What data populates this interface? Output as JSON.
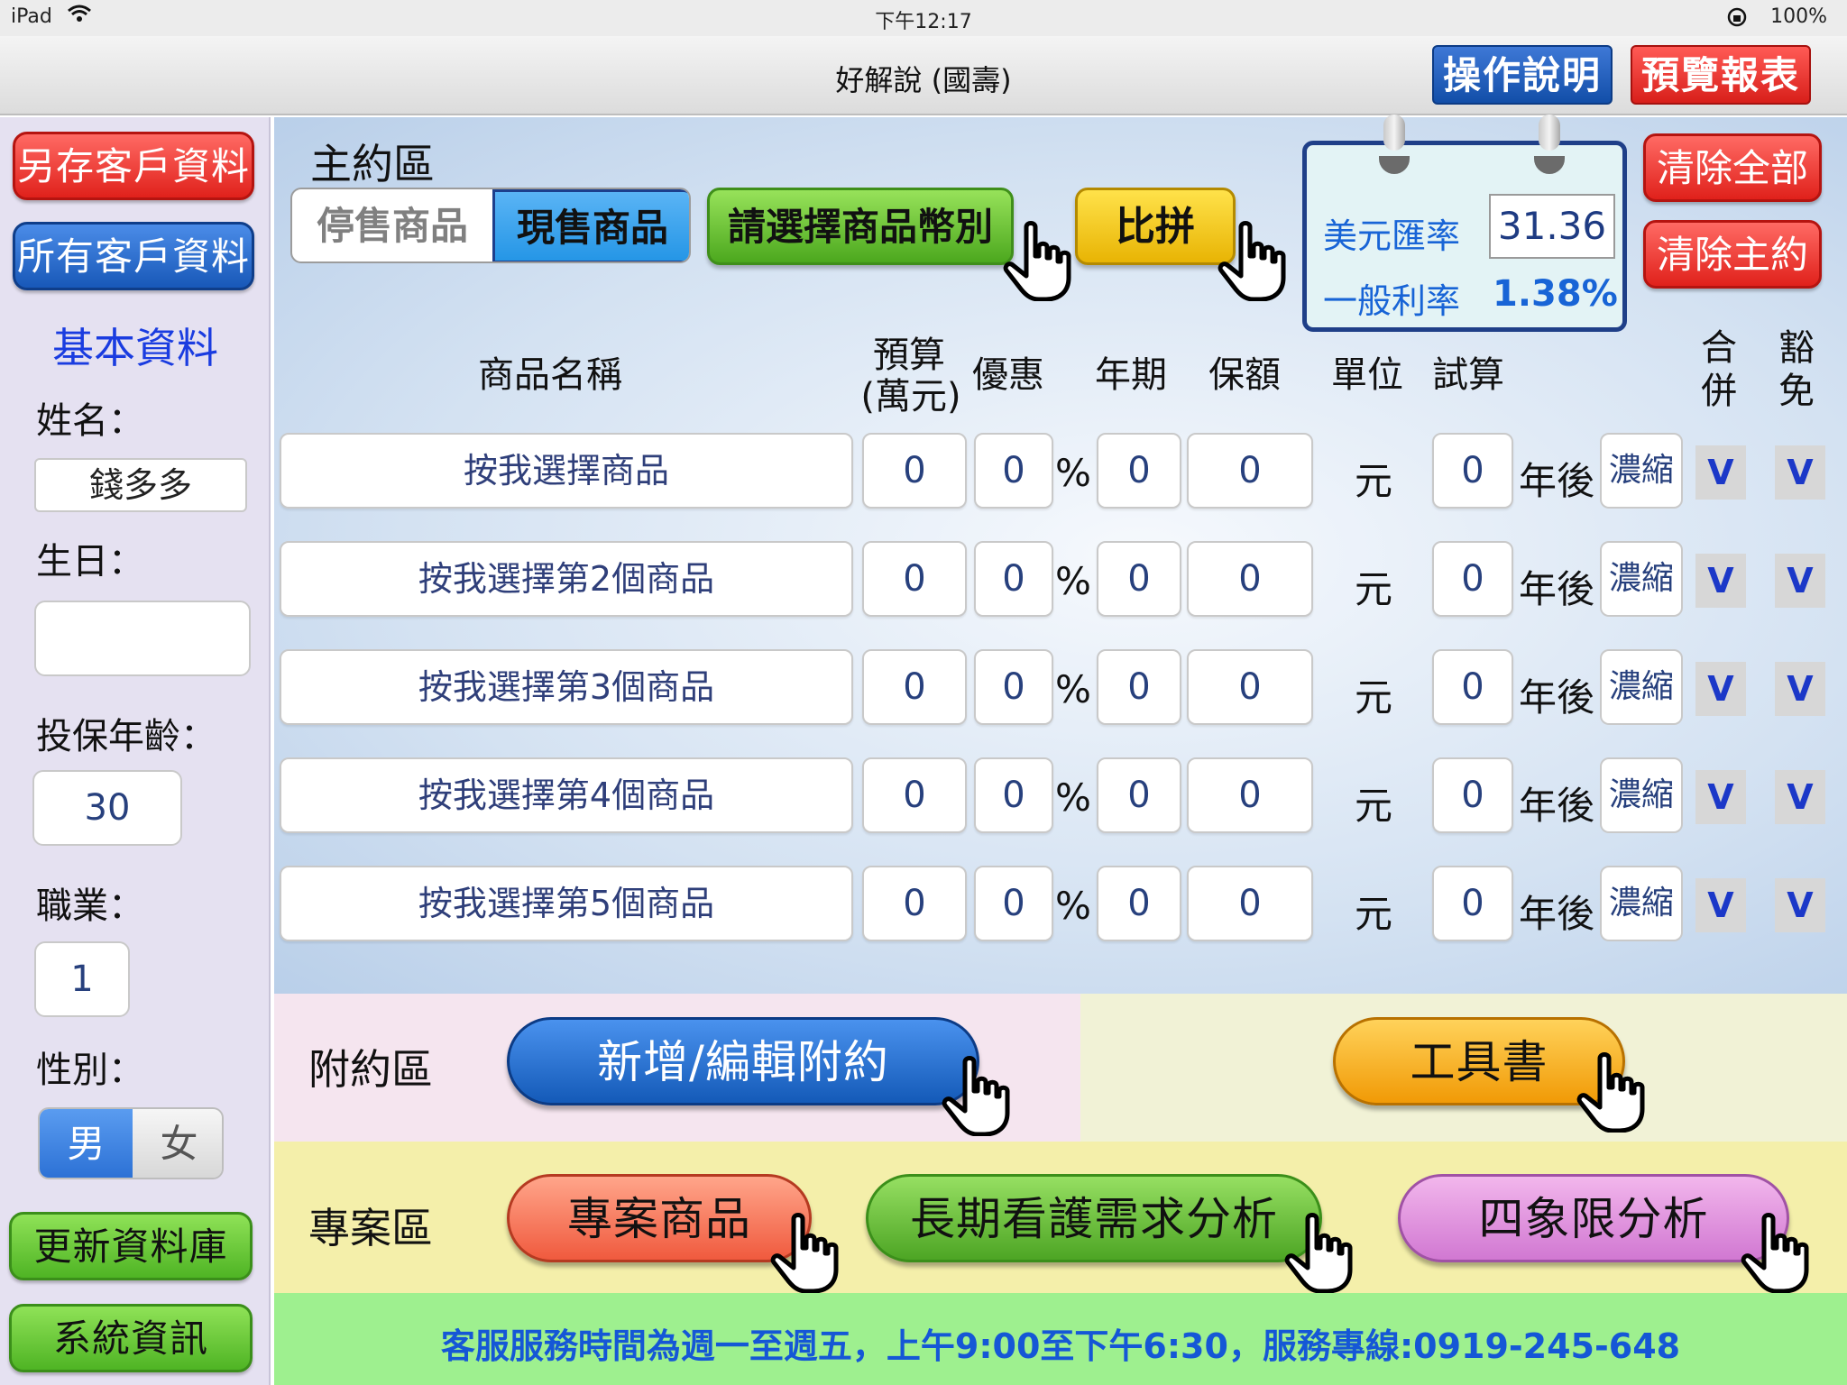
{
  "status_bar": {
    "device": "iPad",
    "time": "下午12:17",
    "battery": "100%"
  },
  "nav": {
    "title": "好解說 (國壽)",
    "help_label": "操作說明",
    "preview_label": "預覽報表"
  },
  "sidebar": {
    "save_client_label": "另存客戶資料",
    "all_clients_label": "所有客戶資料",
    "section_title": "基本資料",
    "name_label": "姓名：",
    "name_value": "錢多多",
    "birthday_label": "生日：",
    "birthday_value": "",
    "age_label": "投保年齡：",
    "age_value": "30",
    "job_label": "職業：",
    "job_value": "1",
    "gender_label": "性別：",
    "gender_options": [
      "男",
      "女"
    ],
    "gender_selected": "男",
    "update_db_label": "更新資料庫",
    "system_info_label": "系統資訊"
  },
  "main": {
    "title": "主約區",
    "tabs": [
      "停售商品",
      "現售商品"
    ],
    "active_tab": "現售商品",
    "currency_button": "請選擇商品幣別",
    "compare_button": "比拼",
    "rates": {
      "usd_label": "美元匯率",
      "usd_value": "31.36",
      "general_label": "一般利率",
      "general_value": "1.38%"
    },
    "clear_all": "清除全部",
    "clear_main": "清除主約",
    "headers": {
      "product": "商品名稱",
      "budget_1": "預算",
      "budget_2": "(萬元)",
      "discount": "優惠",
      "term": "年期",
      "coverage": "保額",
      "unit": "單位",
      "trial": "試算",
      "merge_1": "合",
      "merge_2": "併",
      "waive_1": "豁",
      "waive_2": "免"
    },
    "rows": [
      {
        "product": "按我選擇商品",
        "budget": "0",
        "discount": "0",
        "pct": "%",
        "term": "0",
        "coverage": "0",
        "unit": "元",
        "trial": "0",
        "after": "年後",
        "condense": "濃縮",
        "merge": "V",
        "waive": "V"
      },
      {
        "product": "按我選擇第2個商品",
        "budget": "0",
        "discount": "0",
        "pct": "%",
        "term": "0",
        "coverage": "0",
        "unit": "元",
        "trial": "0",
        "after": "年後",
        "condense": "濃縮",
        "merge": "V",
        "waive": "V"
      },
      {
        "product": "按我選擇第3個商品",
        "budget": "0",
        "discount": "0",
        "pct": "%",
        "term": "0",
        "coverage": "0",
        "unit": "元",
        "trial": "0",
        "after": "年後",
        "condense": "濃縮",
        "merge": "V",
        "waive": "V"
      },
      {
        "product": "按我選擇第4個商品",
        "budget": "0",
        "discount": "0",
        "pct": "%",
        "term": "0",
        "coverage": "0",
        "unit": "元",
        "trial": "0",
        "after": "年後",
        "condense": "濃縮",
        "merge": "V",
        "waive": "V"
      },
      {
        "product": "按我選擇第5個商品",
        "budget": "0",
        "discount": "0",
        "pct": "%",
        "term": "0",
        "coverage": "0",
        "unit": "元",
        "trial": "0",
        "after": "年後",
        "condense": "濃縮",
        "merge": "V",
        "waive": "V"
      }
    ]
  },
  "rider": {
    "label": "附約區",
    "edit_button": "新增/編輯附約",
    "tools_button": "工具書"
  },
  "project": {
    "label": "專案區",
    "project_button": "專案商品",
    "ltc_button": "長期看護需求分析",
    "quad_button": "四象限分析"
  },
  "footer": {
    "text": "客服服務時間為週一至週五，上午9:00至下午6:30，服務專線:0919-245-648"
  }
}
